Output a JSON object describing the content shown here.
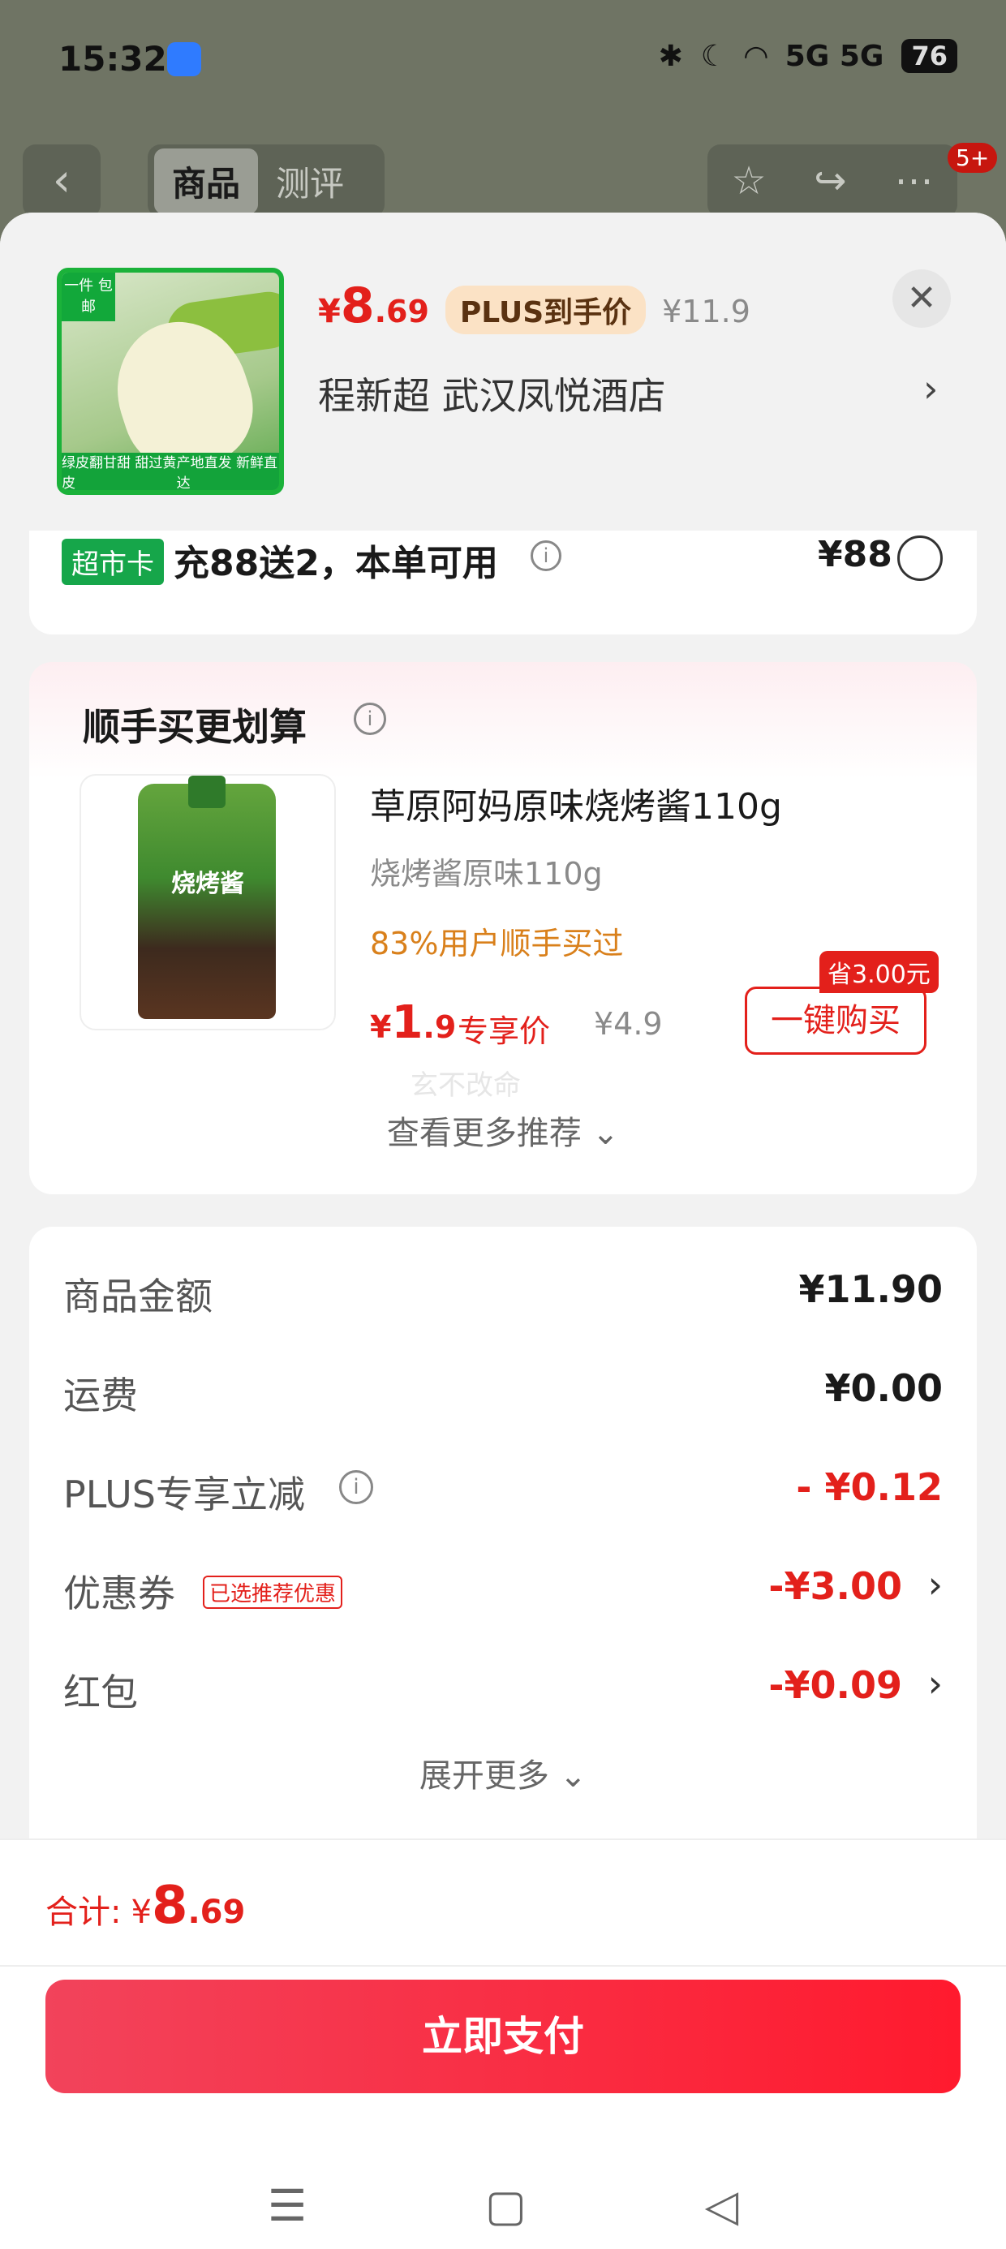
{
  "status_bar": {
    "time": "15:32",
    "network": "5G 5G",
    "battery": "76"
  },
  "nav": {
    "back": "‹",
    "tabs": [
      "商品",
      "测评"
    ],
    "badge": "5+"
  },
  "product": {
    "thumb_tag": "一件\n包邮",
    "thumb_footer_left": "绿皮翻甘甜\n甜过黄皮",
    "thumb_footer_right": "产地直发 新鲜直达",
    "price_symbol": "¥",
    "price_int": "8",
    "price_dec": ".69",
    "plus_badge": "PLUS到手价",
    "original_price": "¥11.9",
    "address": "程新超  武汉凤悦酒店"
  },
  "plus_card": {
    "chip": "超市卡",
    "text": "充88送2，本单可用",
    "amount": "¥88"
  },
  "recommend": {
    "title": "顺手买更划算",
    "pouch_label": "烧烤酱",
    "name": "草原阿妈原味烧烤酱110g",
    "spec": "烧烤酱原味110g",
    "stat": "83%用户顺手买过",
    "price_symbol": "¥",
    "price_int": "1",
    "price_dec": ".9",
    "exclusive": "专享价",
    "original_price": "¥4.9",
    "buy_button": "一键购买",
    "save_tag": "省3.00元",
    "watermark": "玄不改命",
    "more": "查看更多推荐 ⌄"
  },
  "summary": {
    "rows": [
      {
        "label": "商品金额",
        "value": "¥11.90"
      },
      {
        "label": "运费",
        "value": "¥0.00"
      },
      {
        "label": "PLUS专享立减",
        "value": "- ¥0.12"
      },
      {
        "label": "优惠券",
        "tag": "已选推荐优惠",
        "value": "-¥3.00"
      },
      {
        "label": "红包",
        "value": "-¥0.09"
      }
    ],
    "more": "展开更多 ⌄"
  },
  "footer": {
    "total_label": "合计:",
    "total_symbol": "¥",
    "total_int": "8",
    "total_dec": ".69",
    "pay_button": "立即支付"
  },
  "colors": {
    "accent": "#e3201b",
    "pay_gradient_start": "#f2435b",
    "pay_gradient_end": "#ff1a2e",
    "chip_green": "#16a64a"
  }
}
